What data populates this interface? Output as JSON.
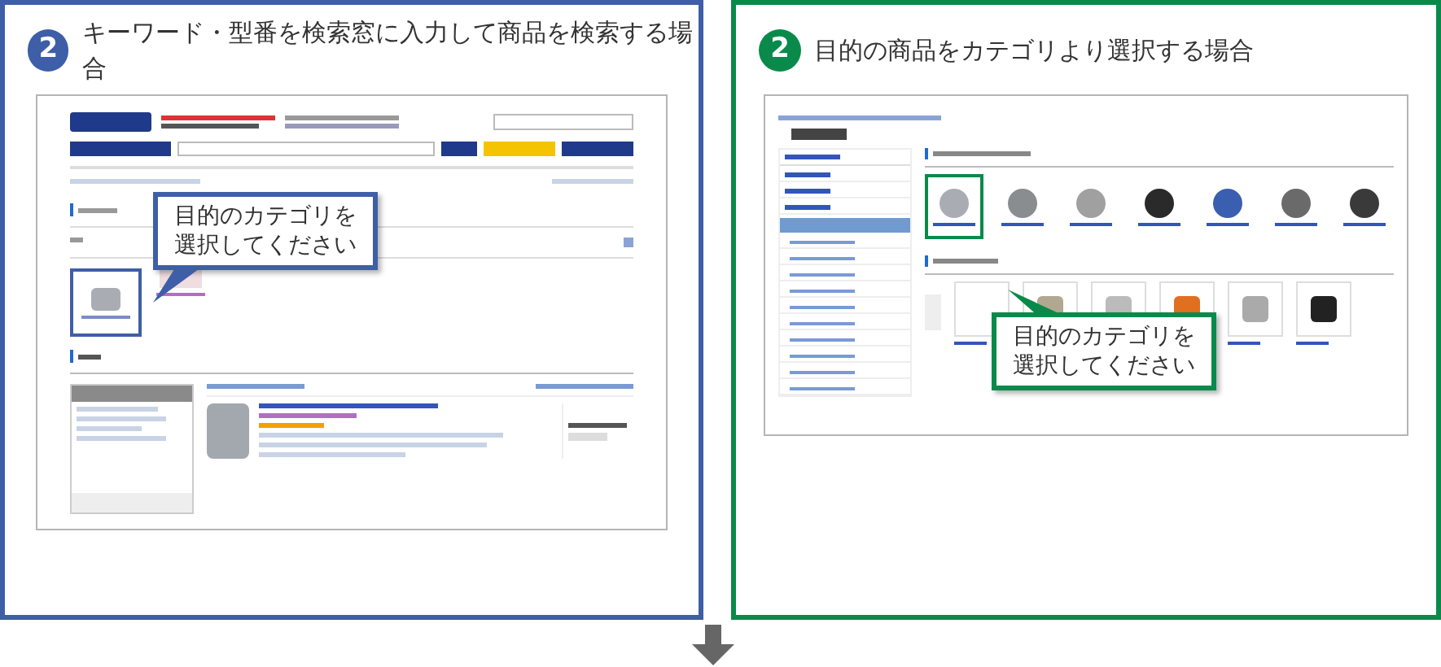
{
  "panels": [
    {
      "kind": "search",
      "number": "2",
      "title": "キーワード・型番を検索窓に入力して商品を検索する場合",
      "color": "#3f5ea8",
      "callout": [
        "目的のカテゴリを",
        "選択してください"
      ]
    },
    {
      "kind": "category",
      "number": "2",
      "title": "目的の商品をカテゴリより選択する場合",
      "color": "#0a8a4a",
      "callout": [
        "目的のカテゴリを",
        "選択してください"
      ]
    }
  ]
}
